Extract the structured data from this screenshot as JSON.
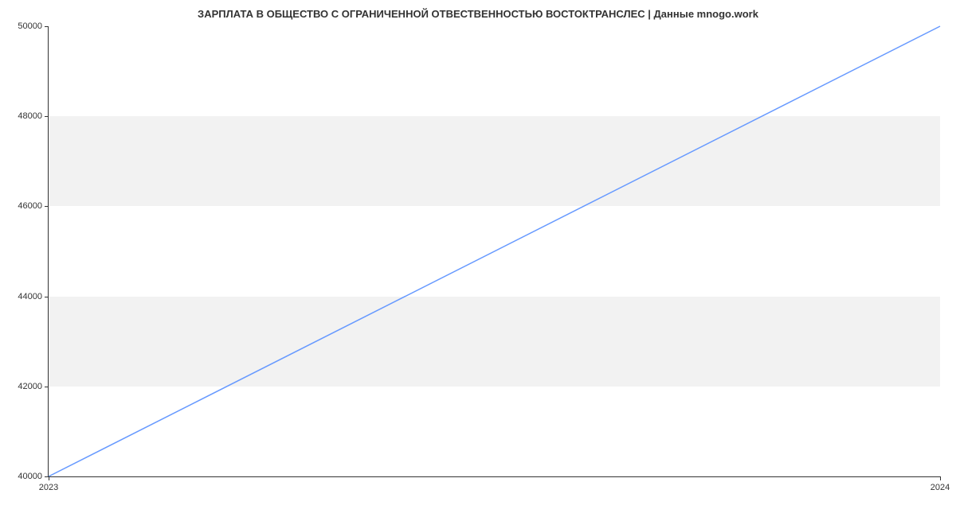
{
  "chart_data": {
    "type": "line",
    "title": "ЗАРПЛАТА В ОБЩЕСТВО С ОГРАНИЧЕННОЙ ОТВЕСТВЕННОСТЬЮ ВОСТОКТРАНСЛЕС | Данные mnogo.work",
    "x": [
      2023,
      2024
    ],
    "values": [
      40000,
      50000
    ],
    "xlabel": "",
    "ylabel": "",
    "x_ticks": [
      2023,
      2024
    ],
    "y_ticks": [
      40000,
      42000,
      44000,
      46000,
      48000,
      50000
    ],
    "ylim": [
      40000,
      50000
    ],
    "xlim": [
      2023,
      2024
    ],
    "bands": [
      {
        "from": 42000,
        "to": 44000
      },
      {
        "from": 46000,
        "to": 48000
      }
    ],
    "line_color": "#6699ff"
  }
}
